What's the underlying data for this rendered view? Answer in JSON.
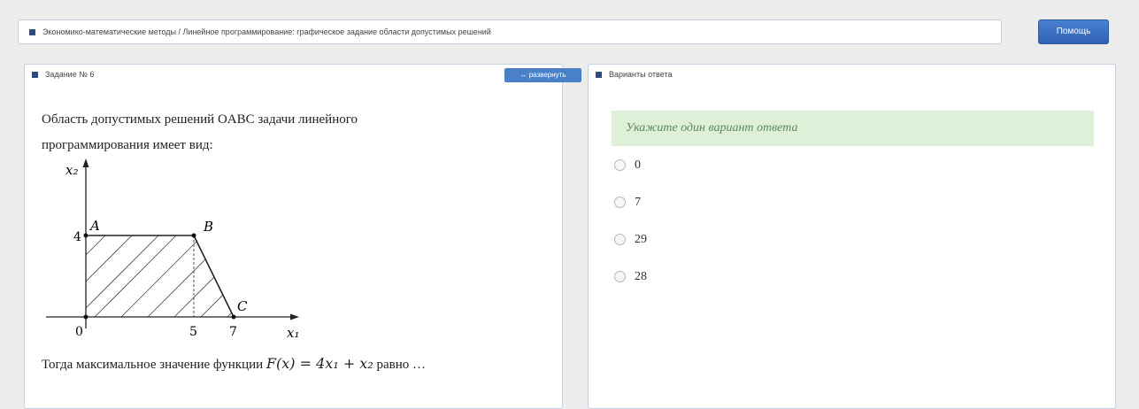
{
  "breadcrumb": "Экономико-математические методы / Линейное программирование: графическое задание области допустимых решений",
  "help_button": "Помощь",
  "task": {
    "header": "Задание № 6",
    "expand_button": "↔ развернуть",
    "question": "Область допустимых решений OABC задачи линейного программирования имеет вид:",
    "conclusion_prefix": "Тогда максимальное значение функции",
    "formula": "F(x) = 4x₁ + x₂",
    "conclusion_suffix": "равно …",
    "graph": {
      "y_axis_label": "x₂",
      "x_axis_label": "x₁",
      "origin_label": "0",
      "point_labels": [
        "A",
        "B",
        "C"
      ],
      "x_ticks": [
        "5",
        "7"
      ],
      "y_ticks": [
        "4"
      ]
    }
  },
  "answers": {
    "header": "Варианты ответа",
    "hint": "Укажите один вариант ответа",
    "options": [
      "0",
      "7",
      "29",
      "28"
    ]
  }
}
